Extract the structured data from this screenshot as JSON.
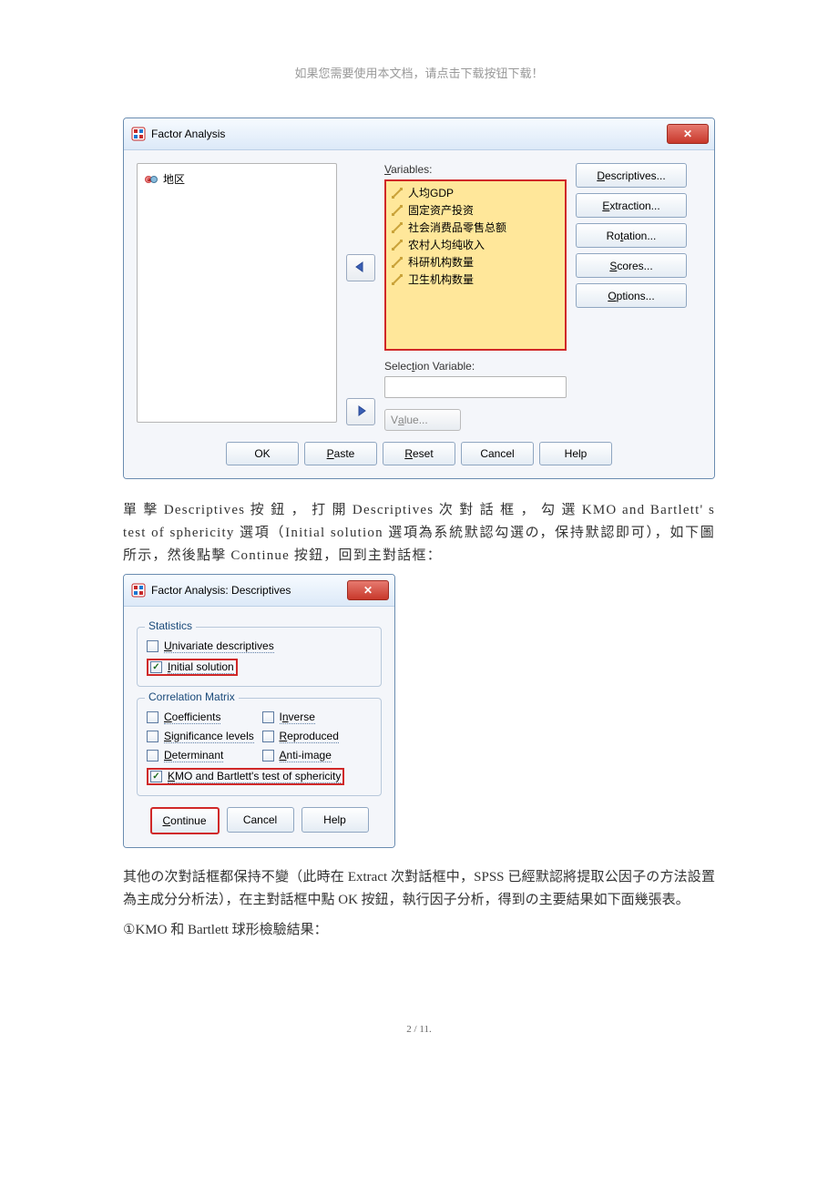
{
  "doc": {
    "header_hint": "如果您需要使用本文档，请点击下载按钮下载！",
    "page_number": "2 / 11."
  },
  "dialog1": {
    "title": "Factor Analysis",
    "left_item": "地区",
    "label_variables": "Variables:",
    "variables": [
      "人均GDP",
      "固定资产投资",
      "社会消费品零售总额",
      "农村人均纯收入",
      "科研机构数量",
      "卫生机构数量"
    ],
    "label_selection": "Selection Variable:",
    "value_btn": "Value...",
    "side_buttons": [
      "Descriptives...",
      "Extraction...",
      "Rotation...",
      "Scores...",
      "Options..."
    ],
    "bottom_buttons": [
      "OK",
      "Paste",
      "Reset",
      "Cancel",
      "Help"
    ]
  },
  "para1": "單 擊 Descriptives 按 鈕 ， 打 開 Descriptives 次 對 話 框 ， 勾 選 KMO and Bartlett' s test of sphericity 選項（Initial solution 選項為系統默認勾選の，保持默認即可），如下圖所示，然後點擊 Continue 按鈕，回到主對話框：",
  "dialog2": {
    "title": "Factor Analysis: Descriptives",
    "group1_title": "Statistics",
    "chk_univariate": "Univariate descriptives",
    "chk_initial": "Initial solution",
    "group2_title": "Correlation Matrix",
    "chk_coeff": "Coefficients",
    "chk_inverse": "Inverse",
    "chk_sig": "Significance levels",
    "chk_repro": "Reproduced",
    "chk_det": "Determinant",
    "chk_anti": "Anti-image",
    "chk_kmo": "KMO and Bartlett's test of sphericity",
    "buttons": [
      "Continue",
      "Cancel",
      "Help"
    ]
  },
  "para2": "其他の次對話框都保持不變（此時在 Extract 次對話框中，SPSS 已經默認將提取公因子の方法設置為主成分分析法），在主對話框中點 OK 按鈕，執行因子分析，得到の主要結果如下面幾張表。",
  "para3": "①KMO 和 Bartlett 球形檢驗結果："
}
